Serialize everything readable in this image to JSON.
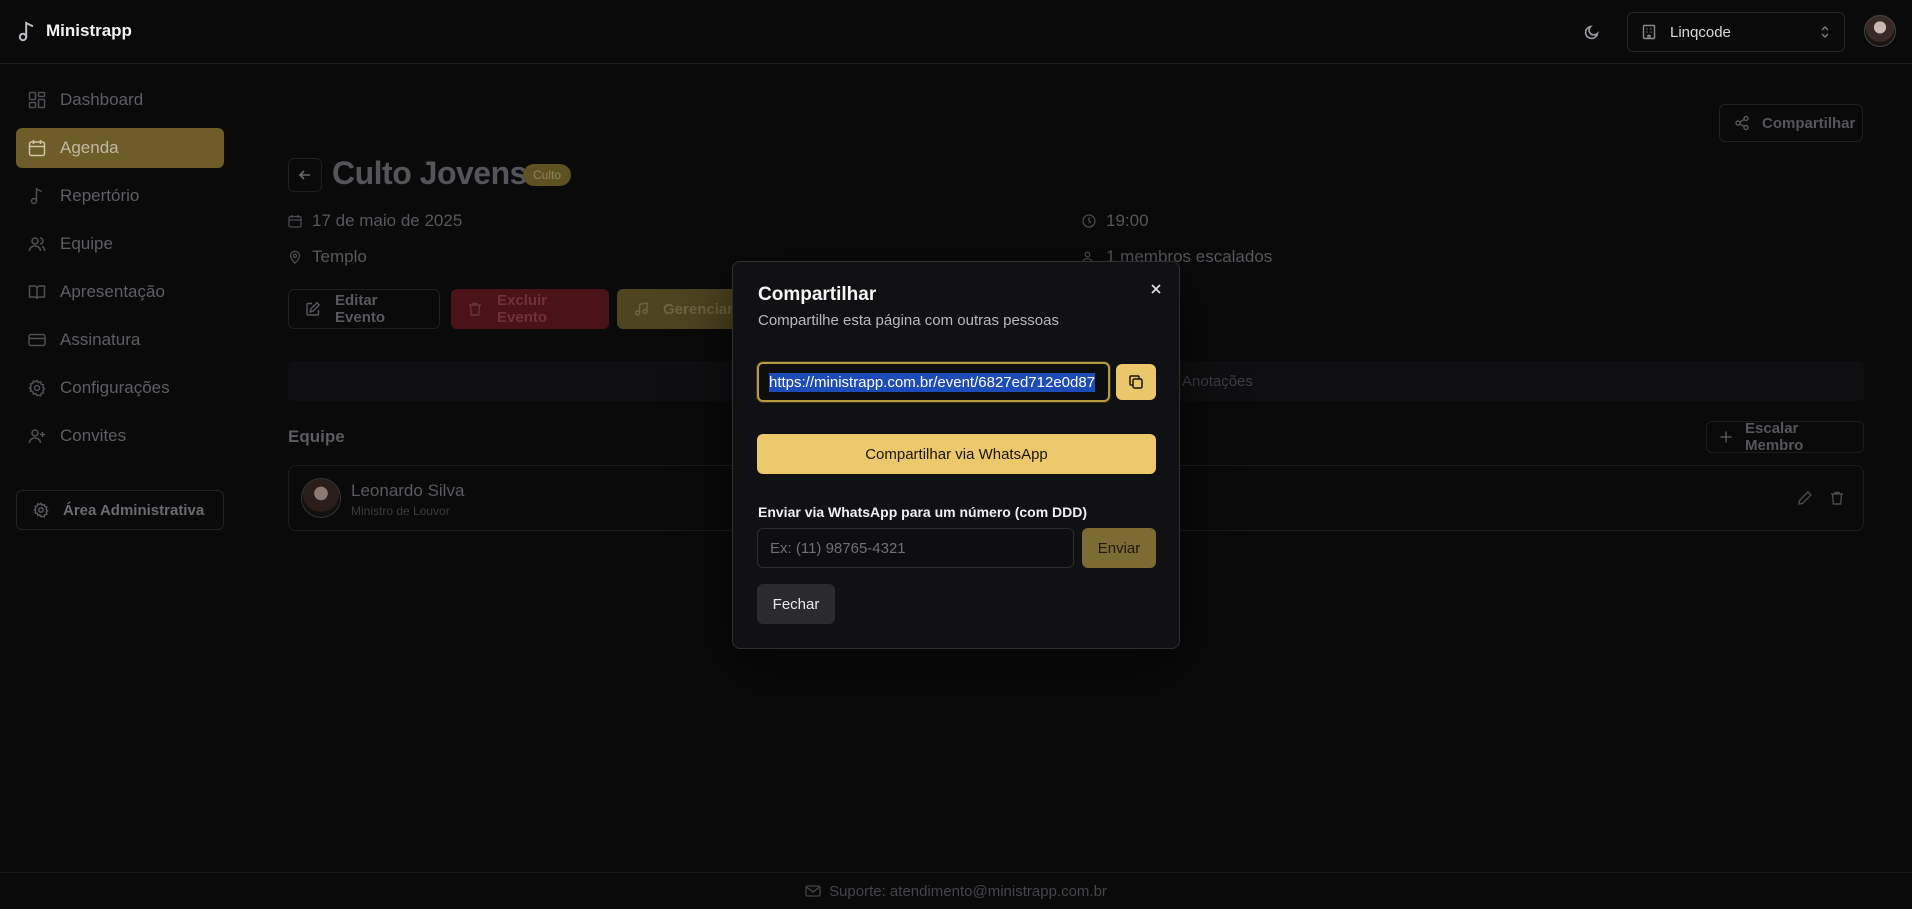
{
  "app": {
    "name": "Ministrapp"
  },
  "header": {
    "org_name": "Linqcode"
  },
  "sidebar": {
    "items": [
      {
        "label": "Dashboard",
        "icon": "dashboard-icon",
        "active": false
      },
      {
        "label": "Agenda",
        "icon": "calendar-icon",
        "active": true
      },
      {
        "label": "Repertório",
        "icon": "music-note-icon",
        "active": false
      },
      {
        "label": "Equipe",
        "icon": "users-icon",
        "active": false
      },
      {
        "label": "Apresentação",
        "icon": "book-icon",
        "active": false
      },
      {
        "label": "Assinatura",
        "icon": "credit-card-icon",
        "active": false
      },
      {
        "label": "Configurações",
        "icon": "gear-icon",
        "active": false
      },
      {
        "label": "Convites",
        "icon": "user-plus-icon",
        "active": false
      }
    ],
    "admin_label": "Área Administrativa"
  },
  "event": {
    "title": "Culto Jovens",
    "badge": "Culto",
    "date": "17 de maio de 2025",
    "location": "Templo",
    "time": "19:00",
    "members_count": "1 membros escalados",
    "share_label": "Compartilhar",
    "edit_label": "Editar Evento",
    "delete_label": "Excluir Evento",
    "manage_label": "Gerenciar",
    "notes_tab": "Anotações"
  },
  "team": {
    "title": "Equipe",
    "add_label": "Escalar Membro",
    "members": [
      {
        "name": "Leonardo Silva",
        "role": "Ministro de Louvor"
      }
    ]
  },
  "footer": {
    "support": "Suporte: atendimento@ministrapp.com.br"
  },
  "modal": {
    "title": "Compartilhar",
    "description": "Compartilhe esta página com outras pessoas",
    "url": "https://ministrapp.com.br/event/6827ed712e0d87",
    "whatsapp_label": "Compartilhar via WhatsApp",
    "phone_label": "Enviar via WhatsApp para um número (com DDD)",
    "phone_placeholder": "Ex: (11) 98765-4321",
    "send_label": "Enviar",
    "close_label": "Fechar"
  },
  "colors": {
    "accent": "#ebc96a",
    "active_nav": "#6e5d28",
    "danger": "#5a1a1c",
    "background": "#0a0a0b"
  }
}
